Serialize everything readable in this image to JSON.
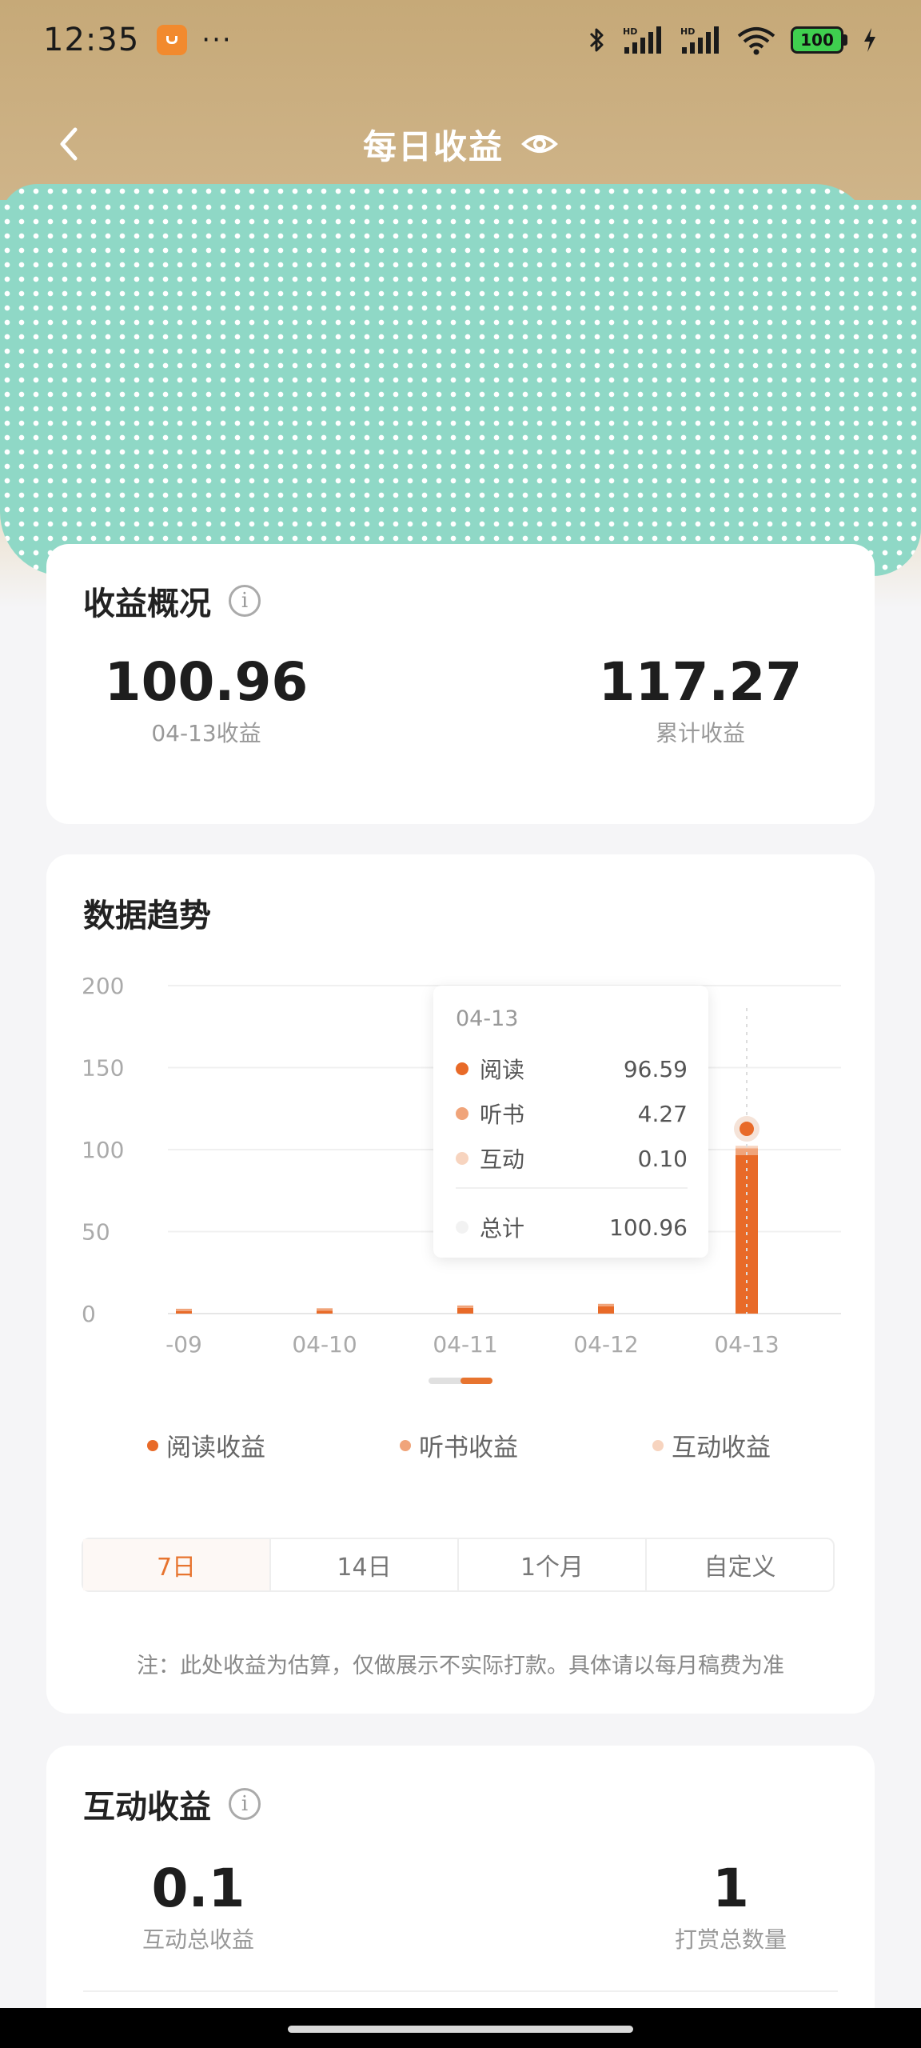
{
  "status_bar": {
    "time": "12:35",
    "more": "···",
    "battery": "100",
    "icons": [
      "app-icon",
      "bluetooth-icon",
      "signal-hd-icon",
      "signal-hd-icon",
      "wifi-icon",
      "battery-icon",
      "charging-icon"
    ]
  },
  "header": {
    "title": "每日收益",
    "back_icon": "chevron-left-icon",
    "eye_icon": "eye-icon"
  },
  "overview": {
    "title": "收益概况",
    "daily_value": "100.96",
    "daily_label": "04-13收益",
    "total_value": "117.27",
    "total_label": "累计收益"
  },
  "trend": {
    "title": "数据趋势",
    "tooltip": {
      "date": "04-13",
      "rows": [
        {
          "label": "阅读",
          "value": "96.59"
        },
        {
          "label": "听书",
          "value": "4.27"
        },
        {
          "label": "互动",
          "value": "0.10"
        }
      ],
      "total_label": "总计",
      "total_value": "100.96"
    },
    "legend": [
      "阅读收益",
      "听书收益",
      "互动收益"
    ],
    "ranges": [
      "7日",
      "14日",
      "1个月",
      "自定义"
    ],
    "active_range": "7日",
    "note": "注：此处收益为估算，仅做展示不实际打款。具体请以每月稿费为准"
  },
  "chart_data": {
    "type": "bar",
    "stacked": true,
    "categories": [
      "-09",
      "04-10",
      "04-11",
      "04-12",
      "04-13"
    ],
    "series": [
      {
        "name": "阅读收益",
        "values": [
          1.5,
          1.8,
          3.5,
          4.5,
          96.59
        ],
        "color": "#e86a28"
      },
      {
        "name": "听书收益",
        "values": [
          0.2,
          0.3,
          0.5,
          0.6,
          4.27
        ],
        "color": "#f0a47a"
      },
      {
        "name": "互动收益",
        "values": [
          0,
          0,
          0,
          0,
          0.1
        ],
        "color": "#f7d4bf"
      }
    ],
    "y_ticks": [
      "0",
      "50",
      "100",
      "150",
      "200"
    ],
    "ylim": [
      0,
      200
    ],
    "grid": true,
    "legend": "bottom"
  },
  "interaction": {
    "title": "互动收益",
    "total_value": "0.1",
    "total_label": "互动总收益",
    "count_value": "1",
    "count_label": "打赏总数量"
  },
  "colors": {
    "accent": "#e7742f",
    "read": "#e86a28",
    "listen": "#f0a47a",
    "interact": "#f7d4bf",
    "header_gold": "#c6a978"
  }
}
